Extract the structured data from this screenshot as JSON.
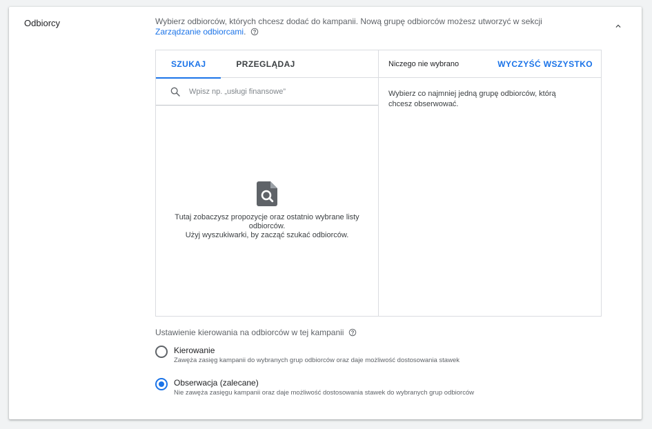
{
  "section": {
    "title": "Odbiorcy",
    "intro_text": "Wybierz odbiorców, których chcesz dodać do kampanii. Nową grupę odbiorców możesz utworzyć w sekcji ",
    "intro_link": "Zarządzanie odbiorcami",
    "intro_end": "."
  },
  "tabs": [
    {
      "label": "SZUKAJ",
      "active": true
    },
    {
      "label": "PRZEGLĄDAJ",
      "active": false
    }
  ],
  "search": {
    "placeholder": "Wpisz np. „usługi finansowe”",
    "value": ""
  },
  "empty_state": {
    "line1": "Tutaj zobaczysz propozycje oraz ostatnio wybrane listy odbiorców.",
    "line2": "Użyj wyszukiwarki, by zacząć szukać odbiorców."
  },
  "selection": {
    "status": "Niczego nie wybrano",
    "clear_all": "WYCZYŚĆ WSZYSTKO",
    "hint": "Wybierz co najmniej jedną grupę odbiorców, którą chcesz obserwować."
  },
  "targeting": {
    "title": "Ustawienie kierowania na odbiorców w tej kampanii",
    "options": [
      {
        "label": "Kierowanie",
        "description": "Zawęża zasięg kampanii do wybranych grup odbiorców oraz daje możliwość dostosowania stawek",
        "selected": false
      },
      {
        "label": "Obserwacja (zalecane)",
        "description": "Nie zawęża zasięgu kampanii oraz daje możliwość dostosowania stawek do wybranych grup odbiorców",
        "selected": true
      }
    ]
  },
  "colors": {
    "accent": "#1a73e8",
    "text": "#202124",
    "secondary_text": "#5f6368",
    "border": "#dadce0"
  },
  "icons": {
    "collapse": "chevron-up-icon",
    "help": "help-circle-icon",
    "search": "search-icon",
    "empty_state": "document-search-icon"
  }
}
